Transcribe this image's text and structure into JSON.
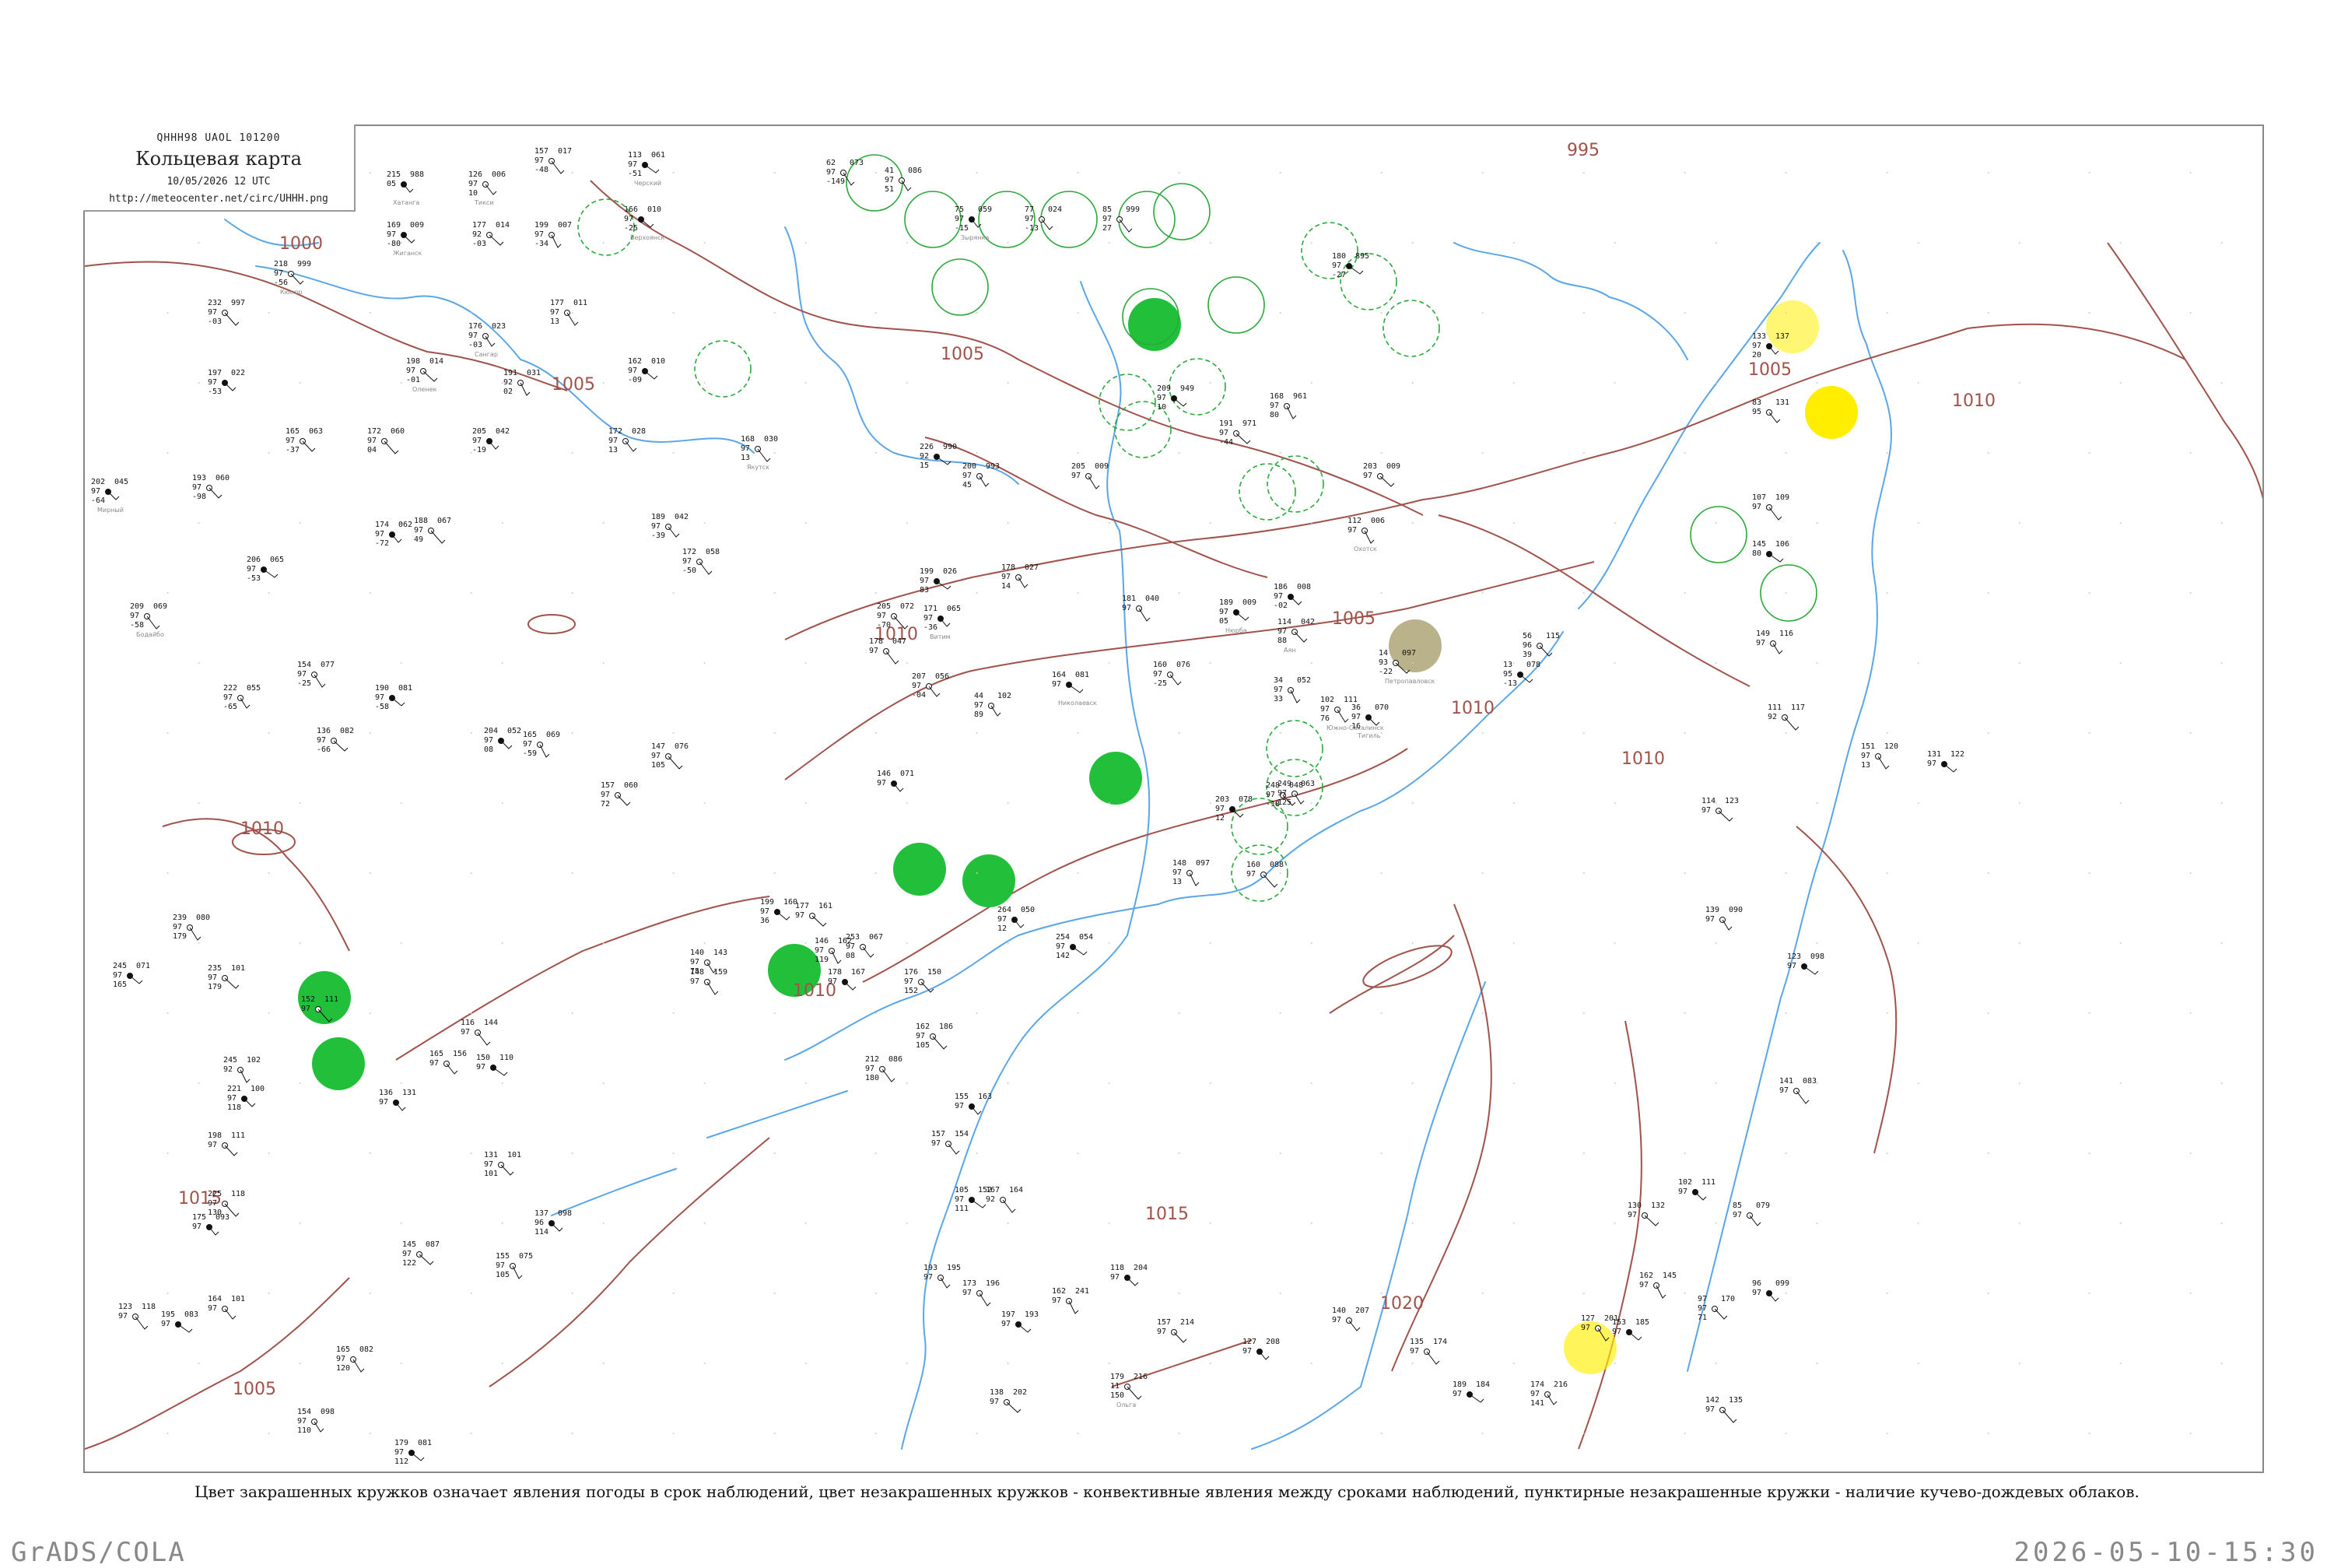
{
  "header": {
    "code": "QHHH98  UAOL  101200",
    "title": "Кольцевая карта",
    "datetime": "10/05/2026 12 UTC",
    "url": "http://meteocenter.net/circ/UHHH.png"
  },
  "caption": "Цвет закрашенных кружков означает явления погоды в срок наблюдений, цвет незакрашенных кружков - конвективные явления между сроками наблюдений, пунктирные незакрашенные кружки - наличие кучево-дождевых облаков.",
  "footer": {
    "software": "GrADS/COLA",
    "timestamp": "2026-05-10-15:30"
  },
  "colors": {
    "isobar": "#a0524a",
    "river": "#5aa6e6",
    "fill_rain": "#22c03a",
    "fill_fog": "#ffee00",
    "fill_haze": "#b9b28a",
    "cb_ring": "#2aa83a"
  },
  "isobar_labels": [
    "995",
    "1000",
    "1005",
    "1005",
    "1005",
    "1005",
    "1010",
    "1010",
    "1010",
    "1010",
    "1010",
    "1010",
    "1015",
    "1015",
    "1020",
    "1005"
  ],
  "stations": [
    {
      "n": "215",
      "p": "988",
      "t": "05",
      "d": "",
      "name": "Хатанга"
    },
    {
      "n": "126",
      "p": "006",
      "t": "97",
      "d": "10",
      "name": "Тикси"
    },
    {
      "n": "157",
      "p": "017",
      "t": "97",
      "d": "-48",
      "name": ""
    },
    {
      "n": "113",
      "p": "061",
      "t": "97",
      "d": "-51",
      "name": "Черский"
    },
    {
      "n": "41",
      "p": "086",
      "t": "97",
      "d": "51",
      "name": ""
    },
    {
      "n": "62",
      "p": "073",
      "t": "97",
      "d": "-149",
      "name": ""
    },
    {
      "n": "166",
      "p": "010",
      "t": "97",
      "d": "-25",
      "name": "Верхоянск"
    },
    {
      "n": "177",
      "p": "014",
      "t": "92",
      "d": "-03",
      "name": ""
    },
    {
      "n": "199",
      "p": "007",
      "t": "97",
      "d": "-34",
      "name": ""
    },
    {
      "n": "169",
      "p": "009",
      "t": "97",
      "d": "-80",
      "name": "Жиганск"
    },
    {
      "n": "218",
      "p": "999",
      "t": "97",
      "d": "-56",
      "name": "Кюсюр"
    },
    {
      "n": "232",
      "p": "997",
      "t": "97",
      "d": "-03",
      "name": ""
    },
    {
      "n": "75",
      "p": "059",
      "t": "97",
      "d": "-15",
      "name": "Зырянка"
    },
    {
      "n": "77",
      "p": "024",
      "t": "97",
      "d": "-13",
      "name": ""
    },
    {
      "n": "85",
      "p": "999",
      "t": "97",
      "d": "27",
      "name": ""
    },
    {
      "n": "180",
      "p": "895",
      "t": "97",
      "d": "-27",
      "name": ""
    },
    {
      "n": "176",
      "p": "023",
      "t": "97",
      "d": "-03",
      "name": "Сангар"
    },
    {
      "n": "177",
      "p": "011",
      "t": "97",
      "d": "13",
      "name": ""
    },
    {
      "n": "162",
      "p": "010",
      "t": "97",
      "d": "-09",
      "name": ""
    },
    {
      "n": "198",
      "p": "014",
      "t": "97",
      "d": "-01",
      "name": "Оленек"
    },
    {
      "n": "191",
      "p": "031",
      "t": "92",
      "d": "02",
      "name": ""
    },
    {
      "n": "197",
      "p": "022",
      "t": "97",
      "d": "-53",
      "name": ""
    },
    {
      "n": "165",
      "p": "063",
      "t": "97",
      "d": "-37",
      "name": ""
    },
    {
      "n": "172",
      "p": "060",
      "t": "97",
      "d": "04",
      "name": ""
    },
    {
      "n": "205",
      "p": "042",
      "t": "97",
      "d": "-19",
      "name": ""
    },
    {
      "n": "172",
      "p": "028",
      "t": "97",
      "d": "13",
      "name": ""
    },
    {
      "n": "168",
      "p": "030",
      "t": "97",
      "d": "13",
      "name": "Якутск"
    },
    {
      "n": "226",
      "p": "990",
      "t": "92",
      "d": "15",
      "name": ""
    },
    {
      "n": "200",
      "p": "993",
      "t": "97",
      "d": "45",
      "name": ""
    },
    {
      "n": "205",
      "p": "009",
      "t": "97",
      "d": "",
      "name": ""
    },
    {
      "n": "209",
      "p": "949",
      "t": "97",
      "d": "10",
      "name": ""
    },
    {
      "n": "191",
      "p": "971",
      "t": "97",
      "d": "-44",
      "name": ""
    },
    {
      "n": "168",
      "p": "961",
      "t": "97",
      "d": "80",
      "name": ""
    },
    {
      "n": "202",
      "p": "045",
      "t": "97",
      "d": "-64",
      "name": "Мирный"
    },
    {
      "n": "193",
      "p": "060",
      "t": "97",
      "d": "-98",
      "name": ""
    },
    {
      "n": "188",
      "p": "067",
      "t": "97",
      "d": "49",
      "name": ""
    },
    {
      "n": "174",
      "p": "062",
      "t": "97",
      "d": "-72",
      "name": ""
    },
    {
      "n": "189",
      "p": "042",
      "t": "97",
      "d": "-39",
      "name": ""
    },
    {
      "n": "172",
      "p": "058",
      "t": "97",
      "d": "-50",
      "name": ""
    },
    {
      "n": "199",
      "p": "026",
      "t": "97",
      "d": "83",
      "name": ""
    },
    {
      "n": "178",
      "p": "027",
      "t": "97",
      "d": "14",
      "name": ""
    },
    {
      "n": "181",
      "p": "040",
      "t": "97",
      "d": "",
      "name": ""
    },
    {
      "n": "189",
      "p": "009",
      "t": "97",
      "d": "05",
      "name": "Нюрба"
    },
    {
      "n": "203",
      "p": "009",
      "t": "97",
      "d": "",
      "name": ""
    },
    {
      "n": "112",
      "p": "006",
      "t": "97",
      "d": "",
      "name": "Охотск"
    },
    {
      "n": "186",
      "p": "008",
      "t": "97",
      "d": "-02",
      "name": ""
    },
    {
      "n": "114",
      "p": "042",
      "t": "97",
      "d": "88",
      "name": "Аян"
    },
    {
      "n": "205",
      "p": "072",
      "t": "97",
      "d": "-70",
      "name": ""
    },
    {
      "n": "171",
      "p": "065",
      "t": "97",
      "d": "-36",
      "name": "Витим"
    },
    {
      "n": "160",
      "p": "076",
      "t": "97",
      "d": "-25",
      "name": ""
    },
    {
      "n": "209",
      "p": "069",
      "t": "97",
      "d": "-58",
      "name": "Бодайбо"
    },
    {
      "n": "206",
      "p": "065",
      "t": "97",
      "d": "-53",
      "name": ""
    },
    {
      "n": "222",
      "p": "055",
      "t": "97",
      "d": "-65",
      "name": ""
    },
    {
      "n": "154",
      "p": "077",
      "t": "97",
      "d": "-25",
      "name": ""
    },
    {
      "n": "190",
      "p": "081",
      "t": "97",
      "d": "-58",
      "name": ""
    },
    {
      "n": "136",
      "p": "082",
      "t": "97",
      "d": "-66",
      "name": ""
    },
    {
      "n": "165",
      "p": "069",
      "t": "97",
      "d": "-59",
      "name": ""
    },
    {
      "n": "204",
      "p": "052",
      "t": "97",
      "d": "08",
      "name": ""
    },
    {
      "n": "157",
      "p": "060",
      "t": "97",
      "d": "72",
      "name": ""
    },
    {
      "n": "147",
      "p": "076",
      "t": "97",
      "d": "105",
      "name": ""
    },
    {
      "n": "146",
      "p": "071",
      "t": "97",
      "d": "",
      "name": ""
    },
    {
      "n": "207",
      "p": "056",
      "t": "97",
      "d": "-04",
      "name": ""
    },
    {
      "n": "178",
      "p": "047",
      "t": "97",
      "d": "",
      "name": ""
    },
    {
      "n": "164",
      "p": "081",
      "t": "97",
      "d": "",
      "name": "Николаевск"
    },
    {
      "n": "44",
      "p": "102",
      "t": "97",
      "d": "89",
      "name": ""
    },
    {
      "n": "102",
      "p": "111",
      "t": "97",
      "d": "76",
      "name": "Южно-Сахалинск"
    },
    {
      "n": "13",
      "p": "078",
      "t": "95",
      "d": "-13",
      "name": ""
    },
    {
      "n": "14",
      "p": "097",
      "t": "93",
      "d": "-22",
      "name": "Петропавловск"
    },
    {
      "n": "34",
      "p": "052",
      "t": "97",
      "d": "33",
      "name": ""
    },
    {
      "n": "36",
      "p": "070",
      "t": "97",
      "d": "16",
      "name": "Тигиль"
    },
    {
      "n": "56",
      "p": "115",
      "t": "96",
      "d": "39",
      "name": ""
    },
    {
      "n": "111",
      "p": "117",
      "t": "92",
      "d": "",
      "name": ""
    },
    {
      "n": "133",
      "p": "137",
      "t": "97",
      "d": "20",
      "name": ""
    },
    {
      "n": "83",
      "p": "131",
      "t": "95",
      "d": "",
      "name": ""
    },
    {
      "n": "107",
      "p": "109",
      "t": "97",
      "d": "",
      "name": ""
    },
    {
      "n": "145",
      "p": "106",
      "t": "80",
      "d": "",
      "name": ""
    },
    {
      "n": "149",
      "p": "116",
      "t": "97",
      "d": "",
      "name": ""
    },
    {
      "n": "151",
      "p": "120",
      "t": "97",
      "d": "13",
      "name": ""
    },
    {
      "n": "131",
      "p": "122",
      "t": "97",
      "d": "",
      "name": ""
    },
    {
      "n": "114",
      "p": "123",
      "t": "97",
      "d": "",
      "name": ""
    },
    {
      "n": "148",
      "p": "097",
      "t": "97",
      "d": "13",
      "name": ""
    },
    {
      "n": "203",
      "p": "078",
      "t": "97",
      "d": "12",
      "name": ""
    },
    {
      "n": "248",
      "p": "048",
      "t": "97",
      "d": "-18",
      "name": ""
    },
    {
      "n": "160",
      "p": "088",
      "t": "97",
      "d": "",
      "name": ""
    },
    {
      "n": "264",
      "p": "050",
      "t": "97",
      "d": "12",
      "name": ""
    },
    {
      "n": "253",
      "p": "067",
      "t": "97",
      "d": "08",
      "name": ""
    },
    {
      "n": "212",
      "p": "086",
      "t": "97",
      "d": "180",
      "name": ""
    },
    {
      "n": "254",
      "p": "054",
      "t": "97",
      "d": "142",
      "name": ""
    },
    {
      "n": "249",
      "p": "063",
      "t": "97",
      "d": "125",
      "name": ""
    },
    {
      "n": "239",
      "p": "080",
      "t": "97",
      "d": "179",
      "name": ""
    },
    {
      "n": "245",
      "p": "071",
      "t": "97",
      "d": "165",
      "name": ""
    },
    {
      "n": "235",
      "p": "101",
      "t": "97",
      "d": "179",
      "name": ""
    },
    {
      "n": "245",
      "p": "102",
      "t": "92",
      "d": "",
      "name": ""
    },
    {
      "n": "221",
      "p": "100",
      "t": "97",
      "d": "118",
      "name": ""
    },
    {
      "n": "198",
      "p": "111",
      "t": "97",
      "d": "",
      "name": ""
    },
    {
      "n": "225",
      "p": "118",
      "t": "97",
      "d": "130",
      "name": ""
    },
    {
      "n": "175",
      "p": "093",
      "t": "97",
      "d": "",
      "name": ""
    },
    {
      "n": "164",
      "p": "101",
      "t": "97",
      "d": "",
      "name": ""
    },
    {
      "n": "123",
      "p": "118",
      "t": "97",
      "d": "",
      "name": ""
    },
    {
      "n": "195",
      "p": "083",
      "t": "97",
      "d": "",
      "name": ""
    },
    {
      "n": "154",
      "p": "098",
      "t": "97",
      "d": "110",
      "name": ""
    },
    {
      "n": "165",
      "p": "082",
      "t": "97",
      "d": "120",
      "name": ""
    },
    {
      "n": "179",
      "p": "081",
      "t": "97",
      "d": "112",
      "name": ""
    },
    {
      "n": "145",
      "p": "087",
      "t": "97",
      "d": "122",
      "name": ""
    },
    {
      "n": "155",
      "p": "075",
      "t": "97",
      "d": "105",
      "name": ""
    },
    {
      "n": "137",
      "p": "098",
      "t": "96",
      "d": "114",
      "name": ""
    },
    {
      "n": "131",
      "p": "101",
      "t": "97",
      "d": "101",
      "name": ""
    },
    {
      "n": "152",
      "p": "111",
      "t": "97",
      "d": "",
      "name": ""
    },
    {
      "n": "136",
      "p": "131",
      "t": "97",
      "d": "",
      "name": ""
    },
    {
      "n": "165",
      "p": "156",
      "t": "97",
      "d": "",
      "name": ""
    },
    {
      "n": "116",
      "p": "144",
      "t": "97",
      "d": "",
      "name": ""
    },
    {
      "n": "150",
      "p": "110",
      "t": "97",
      "d": "",
      "name": ""
    },
    {
      "n": "140",
      "p": "143",
      "t": "97",
      "d": "75",
      "name": ""
    },
    {
      "n": "148",
      "p": "159",
      "t": "97",
      "d": "",
      "name": ""
    },
    {
      "n": "199",
      "p": "160",
      "t": "97",
      "d": "36",
      "name": ""
    },
    {
      "n": "177",
      "p": "161",
      "t": "97",
      "d": "",
      "name": ""
    },
    {
      "n": "146",
      "p": "162",
      "t": "97",
      "d": "119",
      "name": ""
    },
    {
      "n": "178",
      "p": "167",
      "t": "97",
      "d": "",
      "name": ""
    },
    {
      "n": "176",
      "p": "150",
      "t": "97",
      "d": "152",
      "name": ""
    },
    {
      "n": "162",
      "p": "186",
      "t": "97",
      "d": "105",
      "name": ""
    },
    {
      "n": "155",
      "p": "163",
      "t": "97",
      "d": "",
      "name": ""
    },
    {
      "n": "157",
      "p": "154",
      "t": "97",
      "d": "",
      "name": ""
    },
    {
      "n": "167",
      "p": "164",
      "t": "92",
      "d": "",
      "name": ""
    },
    {
      "n": "105",
      "p": "152",
      "t": "97",
      "d": "111",
      "name": ""
    },
    {
      "n": "193",
      "p": "195",
      "t": "97",
      "d": "",
      "name": ""
    },
    {
      "n": "173",
      "p": "196",
      "t": "97",
      "d": "",
      "name": ""
    },
    {
      "n": "197",
      "p": "193",
      "t": "97",
      "d": "",
      "name": ""
    },
    {
      "n": "138",
      "p": "202",
      "t": "97",
      "d": "",
      "name": ""
    },
    {
      "n": "162",
      "p": "241",
      "t": "97",
      "d": "",
      "name": ""
    },
    {
      "n": "118",
      "p": "204",
      "t": "97",
      "d": "",
      "name": ""
    },
    {
      "n": "157",
      "p": "214",
      "t": "97",
      "d": "",
      "name": ""
    },
    {
      "n": "179",
      "p": "216",
      "t": "11",
      "d": "150",
      "name": "Ольга"
    },
    {
      "n": "127",
      "p": "208",
      "t": "97",
      "d": "",
      "name": ""
    },
    {
      "n": "140",
      "p": "207",
      "t": "97",
      "d": "",
      "name": ""
    },
    {
      "n": "135",
      "p": "174",
      "t": "97",
      "d": "",
      "name": ""
    },
    {
      "n": "189",
      "p": "184",
      "t": "97",
      "d": "",
      "name": ""
    },
    {
      "n": "174",
      "p": "216",
      "t": "97",
      "d": "141",
      "name": ""
    },
    {
      "n": "127",
      "p": "201",
      "t": "97",
      "d": "",
      "name": ""
    },
    {
      "n": "153",
      "p": "185",
      "t": "97",
      "d": "",
      "name": ""
    },
    {
      "n": "130",
      "p": "132",
      "t": "97",
      "d": "",
      "name": ""
    },
    {
      "n": "162",
      "p": "145",
      "t": "97",
      "d": "",
      "name": ""
    },
    {
      "n": "102",
      "p": "111",
      "t": "97",
      "d": "",
      "name": ""
    },
    {
      "n": "97",
      "p": "170",
      "t": "97",
      "d": "71",
      "name": ""
    },
    {
      "n": "142",
      "p": "135",
      "t": "97",
      "d": "",
      "name": ""
    },
    {
      "n": "96",
      "p": "099",
      "t": "97",
      "d": "",
      "name": ""
    },
    {
      "n": "85",
      "p": "079",
      "t": "97",
      "d": "",
      "name": ""
    },
    {
      "n": "141",
      "p": "083",
      "t": "97",
      "d": "",
      "name": ""
    },
    {
      "n": "123",
      "p": "098",
      "t": "97",
      "d": "",
      "name": ""
    },
    {
      "n": "139",
      "p": "090",
      "t": "97",
      "d": "",
      "name": ""
    }
  ]
}
